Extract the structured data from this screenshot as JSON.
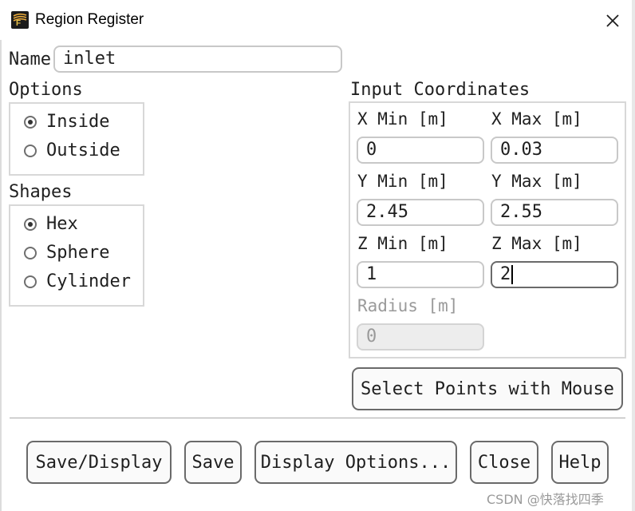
{
  "window": {
    "title": "Region Register",
    "app_icon": "fluent-logo-icon",
    "close_icon": "close-icon"
  },
  "name": {
    "label": "Name",
    "value": "inlet"
  },
  "options": {
    "heading": "Options",
    "items": [
      {
        "label": "Inside",
        "checked": true
      },
      {
        "label": "Outside",
        "checked": false
      }
    ]
  },
  "shapes": {
    "heading": "Shapes",
    "items": [
      {
        "label": "Hex",
        "checked": true
      },
      {
        "label": "Sphere",
        "checked": false
      },
      {
        "label": "Cylinder",
        "checked": false
      }
    ]
  },
  "coords": {
    "heading": "Input Coordinates",
    "x_min": {
      "label": "X Min [m]",
      "value": "0"
    },
    "x_max": {
      "label": "X Max [m]",
      "value": "0.03"
    },
    "y_min": {
      "label": "Y Min [m]",
      "value": "2.45"
    },
    "y_max": {
      "label": "Y Max [m]",
      "value": "2.55"
    },
    "z_min": {
      "label": "Z Min [m]",
      "value": "1"
    },
    "z_max": {
      "label": "Z Max [m]",
      "value": "2"
    },
    "radius": {
      "label": "Radius [m]",
      "value": "0"
    }
  },
  "select_points_label": "Select Points with Mouse",
  "buttons": {
    "save_display": "Save/Display",
    "save": "Save",
    "display_options": "Display Options...",
    "close": "Close",
    "help": "Help"
  },
  "watermark": "CSDN @快落找四季"
}
